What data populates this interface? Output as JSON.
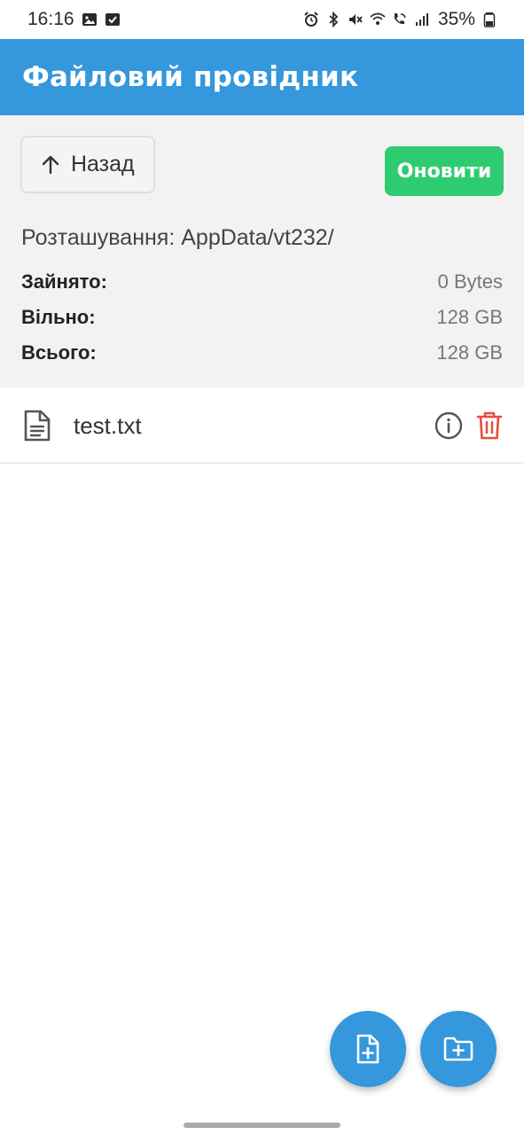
{
  "status_bar": {
    "time": "16:16",
    "left_icons": [
      "image-icon",
      "checkbox-icon"
    ],
    "right_icons": [
      "alarm-icon",
      "bluetooth-icon",
      "mute-icon",
      "wifi-icon",
      "wifi-call-icon",
      "signal-icon"
    ],
    "battery": "35%"
  },
  "app_bar": {
    "title": "Файловий провідник",
    "color": "#3597dc"
  },
  "toolbar": {
    "back_label": "Назад",
    "refresh_label": "Оновити",
    "refresh_color": "#2ecc71"
  },
  "location": "Розташування: AppData/vt232/",
  "storage": {
    "used_label": "Зайнято:",
    "used_value": "0 Bytes",
    "free_label": "Вільно:",
    "free_value": "128 GB",
    "total_label": "Всього:",
    "total_value": "128 GB"
  },
  "files": [
    {
      "name": "test.txt",
      "icon": "document-icon"
    }
  ],
  "fabs": {
    "new_file_icon": "file-plus-icon",
    "new_folder_icon": "folder-plus-icon"
  },
  "colors": {
    "delete": "#e74c3c"
  }
}
